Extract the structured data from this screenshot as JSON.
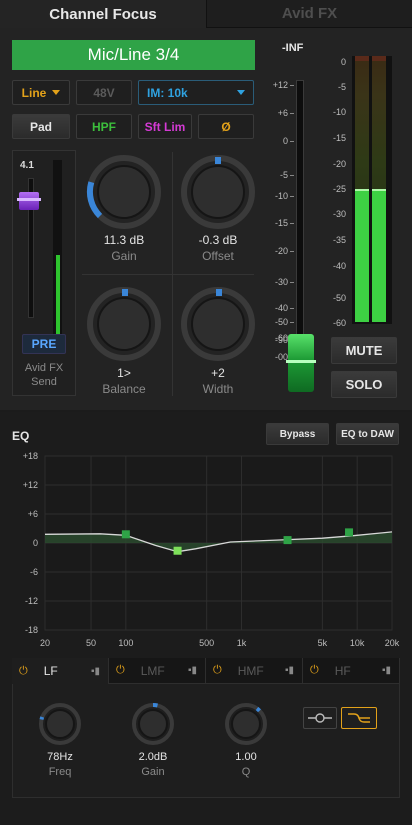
{
  "tabs": {
    "channel_focus": "Channel Focus",
    "avid_fx": "Avid FX"
  },
  "channel": {
    "name": "Mic/Line 3/4",
    "input_type": "Line",
    "phantom": "48V",
    "input_mode": "IM: 10k",
    "pad": "Pad",
    "hpf": "HPF",
    "soft_limit": "Sft Lim",
    "phase": "Ø"
  },
  "send": {
    "value": "4.1",
    "pre": "PRE",
    "label_line1": "Avid FX",
    "label_line2": "Send",
    "level": 0.78
  },
  "knobs": {
    "gain": {
      "value": "11.3 dB",
      "label": "Gain"
    },
    "offset": {
      "value": "-0.3 dB",
      "label": "Offset"
    },
    "balance": {
      "value": "1>",
      "label": "Balance"
    },
    "width": {
      "value": "+2",
      "label": "Width"
    }
  },
  "fader": {
    "peak": "-INF",
    "scale": [
      "+12",
      "+6",
      "0",
      "-5",
      "-10",
      "-15",
      "-20",
      "-30",
      "-40",
      "-50",
      "-60",
      "-90",
      "-00"
    ]
  },
  "meter": {
    "scale": [
      "0",
      "-5",
      "-10",
      "-15",
      "-20",
      "-25",
      "-30",
      "-35",
      "-40",
      "-50",
      "-60"
    ],
    "level_db": -25
  },
  "buttons": {
    "mute": "MUTE",
    "solo": "SOLO",
    "bypass": "Bypass",
    "eq_to_daw": "EQ to DAW"
  },
  "eq": {
    "title": "EQ",
    "y_ticks": [
      "+18",
      "+12",
      "+6",
      "0",
      "-6",
      "-12",
      "-18"
    ],
    "x_ticks": [
      "20",
      "50",
      "100",
      "500",
      "1k",
      "5k",
      "10k",
      "20k"
    ],
    "bands": [
      {
        "name": "LF",
        "active": true
      },
      {
        "name": "LMF",
        "active": false
      },
      {
        "name": "HMF",
        "active": false
      },
      {
        "name": "HF",
        "active": false
      }
    ],
    "freq": {
      "value": "78Hz",
      "label": "Freq"
    },
    "gain": {
      "value": "2.0dB",
      "label": "Gain"
    },
    "q": {
      "value": "1.00",
      "label": "Q"
    },
    "power_glyph": "⏻",
    "bars_glyph": "▪▮"
  },
  "colors": {
    "accent_green": "#2fa347",
    "hpf_green": "#3cbf3c",
    "sft_lim_pink": "#d43ad4",
    "phase_orange": "#e3a21a",
    "im_blue": "#2fa2e0",
    "knob_blue": "#3a86d8",
    "send_purple": "#8b3ad8"
  }
}
